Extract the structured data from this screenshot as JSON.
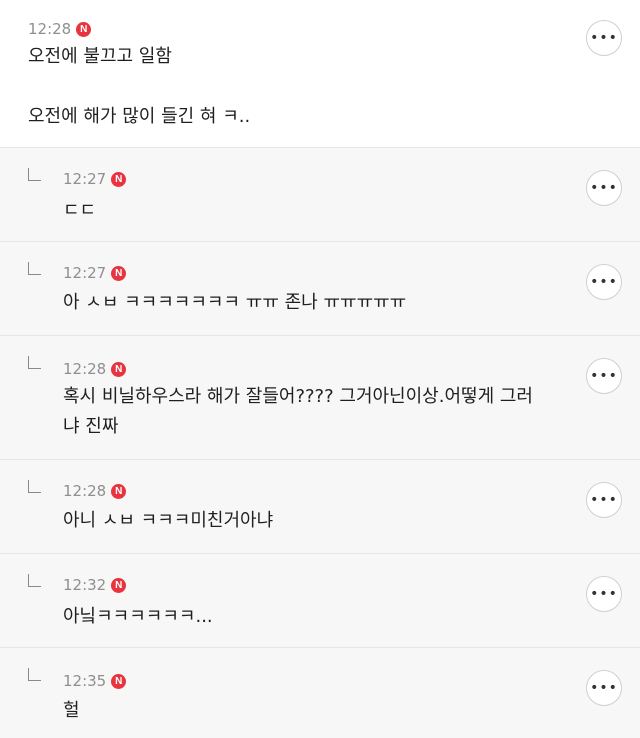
{
  "comments": [
    {
      "time": "12:28",
      "badge": "N",
      "lines": [
        "오전에 불끄고 일함",
        "",
        "오전에 해가 많이 들긴 혀 ㅋ.."
      ]
    },
    {
      "time": "12:27",
      "badge": "N",
      "lines": [
        "ㄷㄷ"
      ]
    },
    {
      "time": "12:27",
      "badge": "N",
      "lines": [
        "아 ㅅㅂ ㅋㅋㅋㅋㅋㅋㅋ ㅠㅠ 존나 ㅠㅠㅠㅠㅠ"
      ]
    },
    {
      "time": "12:28",
      "badge": "N",
      "lines": [
        "혹시 비닐하우스라 해가 잘들어???? 그거아닌이상.어떻게 그러",
        "냐 진짜"
      ]
    },
    {
      "time": "12:28",
      "badge": "N",
      "lines": [
        "아니 ㅅㅂ ㅋㅋㅋ미친거아냐"
      ]
    },
    {
      "time": "12:32",
      "badge": "N",
      "lines": [
        "아닠ㅋㅋㅋㅋㅋㅋ..."
      ]
    },
    {
      "time": "12:35",
      "badge": "N",
      "lines": [
        "헐"
      ]
    }
  ],
  "more_label": "•••",
  "icons": {
    "more": "more-horizontal-icon",
    "reply": "reply-arrow-icon",
    "new": "new-badge-icon"
  },
  "colors": {
    "badge": "#e8343f",
    "time": "#8f8f8f",
    "divider": "#e6e6e6"
  }
}
